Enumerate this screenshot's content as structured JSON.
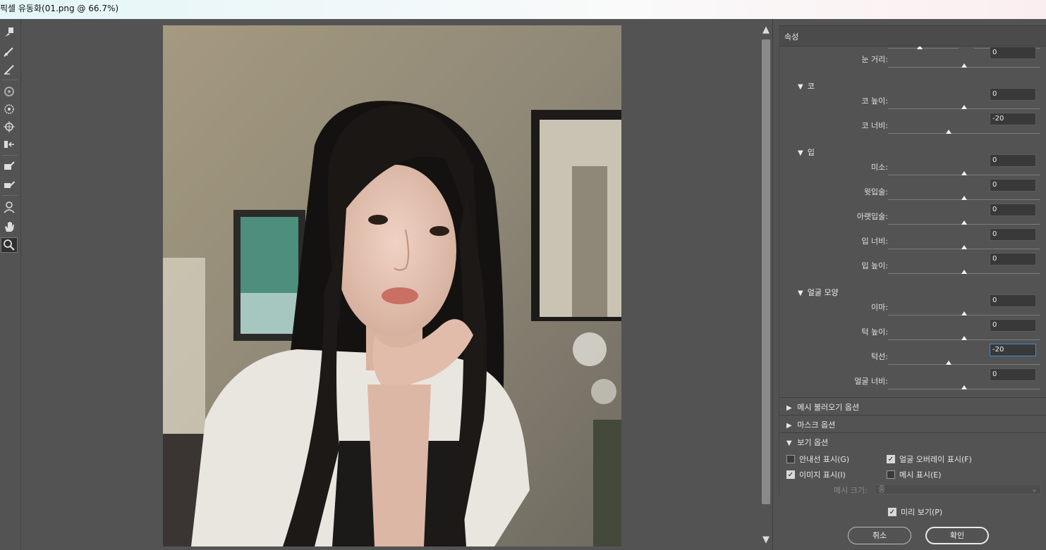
{
  "window": {
    "title": "픽셀 유동화(01.png @ 66.7%)"
  },
  "tools": [
    "forward-warp",
    "reconstruct",
    "smooth",
    "twirl",
    "pucker",
    "bloat",
    "push-left",
    "freeze-mask",
    "thaw-mask",
    "face-tool",
    "hand",
    "zoom"
  ],
  "panel": {
    "title": "속성",
    "eye_distance": {
      "label": "눈 거리:",
      "value": "0",
      "slider": 0.5
    },
    "nose_group": "코",
    "nose": [
      {
        "label": "코 높이:",
        "value": "0",
        "slider": 0.5
      },
      {
        "label": "코 너비:",
        "value": "-20",
        "slider": 0.4
      }
    ],
    "mouth_group": "입",
    "mouth": [
      {
        "label": "미소:",
        "value": "0",
        "slider": 0.5
      },
      {
        "label": "윗입술:",
        "value": "0",
        "slider": 0.5
      },
      {
        "label": "아랫입술:",
        "value": "0",
        "slider": 0.5
      },
      {
        "label": "입 너비:",
        "value": "0",
        "slider": 0.5
      },
      {
        "label": "입 높이:",
        "value": "0",
        "slider": 0.5
      }
    ],
    "face_group": "얼굴 모양",
    "face": [
      {
        "label": "이마:",
        "value": "0",
        "slider": 0.5
      },
      {
        "label": "턱 높이:",
        "value": "0",
        "slider": 0.5
      },
      {
        "label": "턱선:",
        "value": "-20",
        "slider": 0.4
      },
      {
        "label": "얼굴 너비:",
        "value": "0",
        "slider": 0.5
      }
    ],
    "sections": {
      "load_mesh": "메시 불러오기 옵션",
      "mask": "마스크 옵션",
      "view": "보기 옵션"
    },
    "view_options": {
      "show_guides": {
        "label": "안내선 표시(G)",
        "checked": false
      },
      "show_face_overlay": {
        "label": "얼굴 오버레이 표시(F)",
        "checked": true
      },
      "show_image": {
        "label": "이미지 표시(I)",
        "checked": true
      },
      "show_mesh": {
        "label": "메시 표시(E)",
        "checked": false
      },
      "mesh_size_label": "메시 크기:",
      "mesh_size_value": "중"
    },
    "preview": {
      "label": "미리 보기(P)",
      "checked": true
    },
    "cancel_label": "취소",
    "ok_label": "확인"
  }
}
